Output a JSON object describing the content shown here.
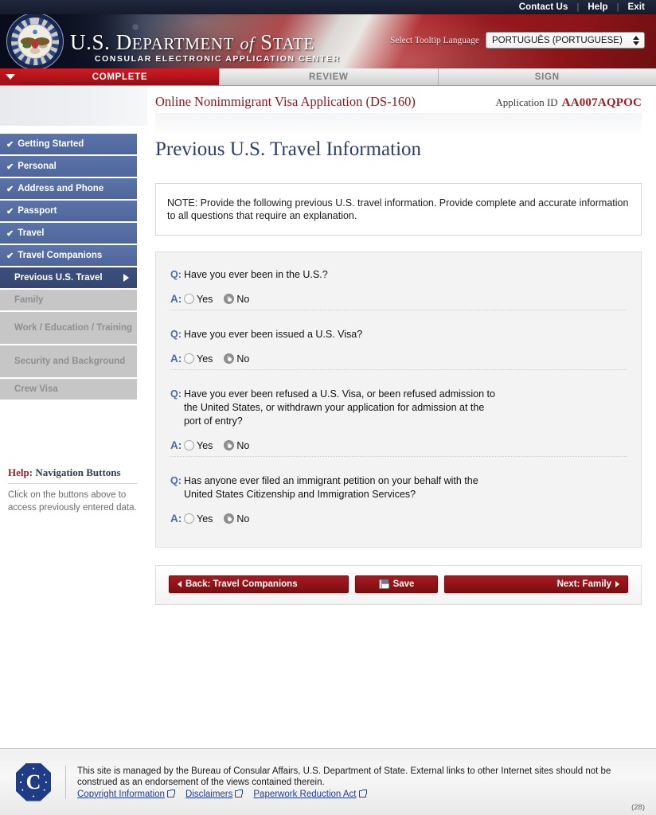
{
  "utility": {
    "links": [
      {
        "label": "Contact Us"
      },
      {
        "label": "Help"
      },
      {
        "label": "Exit"
      }
    ],
    "separator": "|"
  },
  "banner": {
    "dept_line_1_a": "U.S. D",
    "dept_line_1_b": "EPARTMENT",
    "dept_line_1_c": "of",
    "dept_line_1_d": "S",
    "dept_line_1_e": "TATE",
    "dept_subtitle": "CONSULAR ELECTRONIC APPLICATION CENTER",
    "language_label": "Select Tooltip Language",
    "language_value": "PORTUGUÊS (PORTUGUESE)",
    "seal_icon": "department-of-state-seal"
  },
  "steps": [
    {
      "label": "COMPLETE",
      "state": "active"
    },
    {
      "label": "REVIEW",
      "state": "inactive"
    },
    {
      "label": "SIGN",
      "state": "inactive"
    }
  ],
  "sidebar": {
    "items": [
      {
        "label": "Getting Started",
        "state": "done",
        "check": "✔"
      },
      {
        "label": "Personal",
        "state": "done",
        "check": "✔"
      },
      {
        "label": "Address and Phone",
        "state": "done",
        "check": "✔"
      },
      {
        "label": "Passport",
        "state": "done",
        "check": "✔"
      },
      {
        "label": "Travel",
        "state": "done",
        "check": "✔"
      },
      {
        "label": "Travel Companions",
        "state": "done",
        "check": "✔"
      },
      {
        "label": "Previous U.S. Travel",
        "state": "current",
        "check": ""
      },
      {
        "label": "Family",
        "state": "disabled",
        "check": ""
      },
      {
        "label": "Work / Education / Training",
        "state": "disabled",
        "check": ""
      },
      {
        "label": "Security and Background",
        "state": "disabled",
        "check": ""
      },
      {
        "label": "Crew Visa",
        "state": "disabled",
        "check": ""
      }
    ],
    "help": {
      "title_prefix": "Help:",
      "title": "Navigation Buttons",
      "body": "Click on the buttons above to access previously entered data."
    }
  },
  "main": {
    "app_title": "Online Nonimmigrant Visa Application (DS-160)",
    "application_id_label": "Application ID",
    "application_id": "AA007AQPOC",
    "page_title": "Previous U.S. Travel Information",
    "note": "NOTE: Provide the following previous U.S. travel information. Provide complete and accurate information to all questions that require an explanation.",
    "q_marker": "Q:",
    "a_marker": "A:",
    "questions": [
      {
        "question": "Have you ever been in the U.S.?",
        "options": [
          {
            "label": "Yes",
            "selected": false
          },
          {
            "label": "No",
            "selected": true
          }
        ]
      },
      {
        "question": "Have you ever been issued a U.S. Visa?",
        "options": [
          {
            "label": "Yes",
            "selected": false
          },
          {
            "label": "No",
            "selected": true
          }
        ]
      },
      {
        "question": "Have you ever been refused a U.S. Visa, or been refused admission to the United States, or withdrawn your application for admission at the port of entry?",
        "options": [
          {
            "label": "Yes",
            "selected": false
          },
          {
            "label": "No",
            "selected": true
          }
        ]
      },
      {
        "question": "Has anyone ever filed an immigrant petition on your behalf with the United States Citizenship and Immigration Services?",
        "options": [
          {
            "label": "Yes",
            "selected": false
          },
          {
            "label": "No",
            "selected": true
          }
        ]
      }
    ]
  },
  "buttons": {
    "back": "Back: Travel Companions",
    "save": "Save",
    "next": "Next: Family"
  },
  "footer": {
    "seal_icon": "consular-affairs-seal",
    "text": "This site is managed by the Bureau of Consular Affairs, U.S. Department of State. External links to other Internet sites should not be construed as an endorsement of the views contained therein.",
    "links": [
      {
        "label": "Copyright Information"
      },
      {
        "label": "Disclaimers"
      },
      {
        "label": "Paperwork Reduction Act"
      }
    ],
    "page_number": "(28)"
  },
  "colors": {
    "brand_red": "#8f1318",
    "brand_navy": "#2c3e6b",
    "sidebar_done": "#5b74a8",
    "sidebar_current": "#3c4f7f",
    "sidebar_disabled": "#c6c6c6",
    "link_blue": "#20409a"
  }
}
